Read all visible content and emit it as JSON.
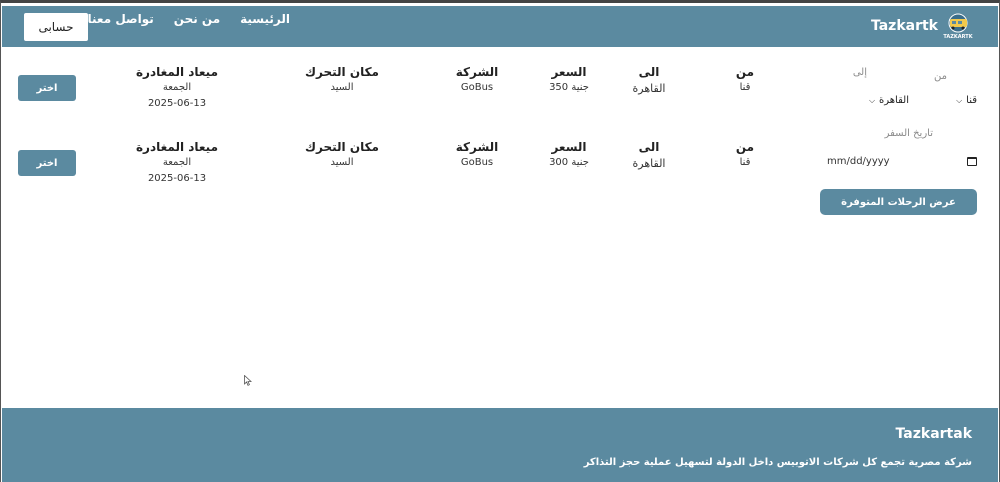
{
  "nav": {
    "brand": "Tazkartk",
    "logo_text": "TAZKARTK",
    "links": [
      "الرئيسية",
      "من نحن",
      "تواصل معنا"
    ],
    "account_label": "حسابى"
  },
  "search": {
    "from_label": "من",
    "to_label": "إلى",
    "from_value": "قنا",
    "to_value": "القاهرة",
    "date_label": "تاريخ السفر",
    "date_placeholder": "mm/dd/yyyy",
    "submit_label": "عرض الرحلات المتوفرة"
  },
  "trips": [
    {
      "from_h": "من",
      "from_v": "قنا",
      "to_h": "الى",
      "to_v": "القاهرة",
      "price_h": "السعر",
      "price_v": "جنية 350",
      "company_h": "الشركة",
      "company_v": "GoBus",
      "place_h": "مكان التحرك",
      "place_v": "السيد",
      "depart_h": "ميعاد المغادرة",
      "depart_day": "الجمعة",
      "depart_date": "2025-06-13",
      "choose_label": "اختر"
    },
    {
      "from_h": "من",
      "from_v": "قنا",
      "to_h": "الى",
      "to_v": "القاهرة",
      "price_h": "السعر",
      "price_v": "جنية 300",
      "company_h": "الشركة",
      "company_v": "GoBus",
      "place_h": "مكان التحرك",
      "place_v": "السيد",
      "depart_h": "ميعاد المغادرة",
      "depart_day": "الجمعة",
      "depart_date": "2025-06-13",
      "choose_label": "اختر"
    }
  ],
  "footer": {
    "title": "Tazkartak",
    "description": "شركة مصرية تجمع كل شركات الاتوبيس داخل الدولة لتسهيل عملية حجز التذاكر"
  },
  "colors": {
    "primary": "#5b8aa0",
    "background": "#ffffff",
    "text": "#222222"
  }
}
